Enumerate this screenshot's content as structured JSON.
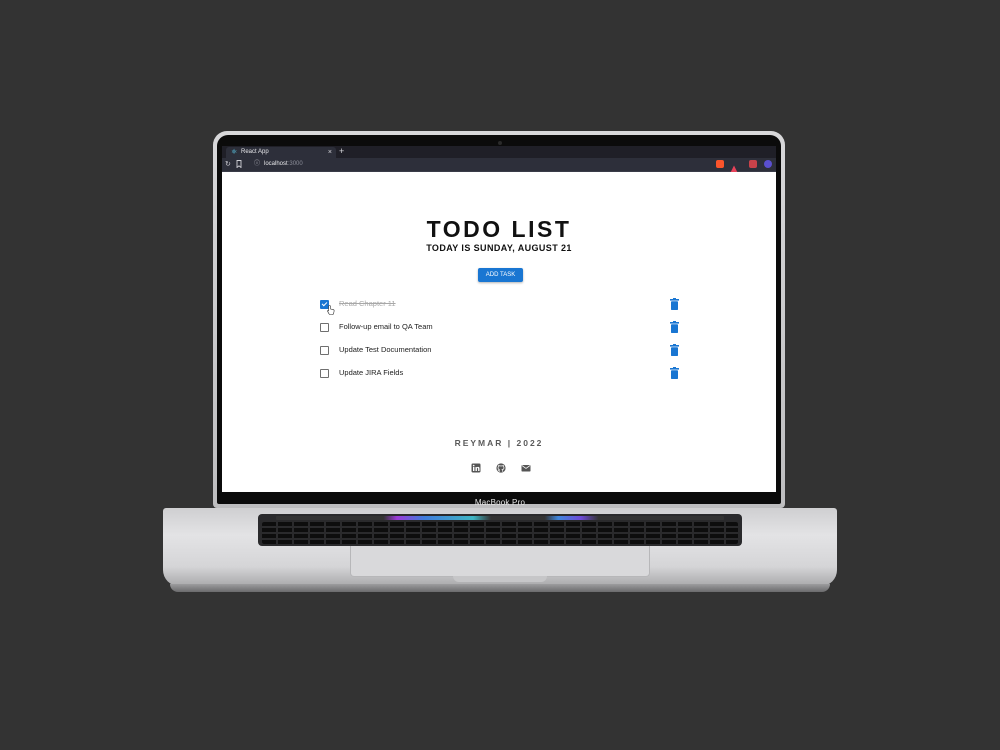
{
  "device": {
    "brand_label": "MacBook Pro"
  },
  "browser": {
    "tab": {
      "title": "React App",
      "favicon": "react-icon",
      "close_label": "×"
    },
    "new_tab_label": "+",
    "url": {
      "host": "localhost",
      "port": ":3000"
    },
    "extensions": [
      "brave-shield-icon",
      "brave-rewards-icon",
      "extension-icon",
      "profile-icon"
    ]
  },
  "app": {
    "title": "TODO LIST",
    "subtitle": "TODAY IS SUNDAY, AUGUST 21",
    "add_button_label": "ADD TASK",
    "tasks": [
      {
        "label": "Read Chapter 11",
        "completed": true
      },
      {
        "label": "Follow-up email to QA Team",
        "completed": false
      },
      {
        "label": "Update Test Documentation",
        "completed": false
      },
      {
        "label": "Update JIRA Fields",
        "completed": false
      }
    ],
    "footer": "REYMAR | 2022",
    "social_icons": [
      "linkedin-icon",
      "github-icon",
      "email-icon"
    ]
  },
  "colors": {
    "background": "#333333",
    "accent": "#1976d2",
    "browser_chrome": "#2d2f3a"
  }
}
